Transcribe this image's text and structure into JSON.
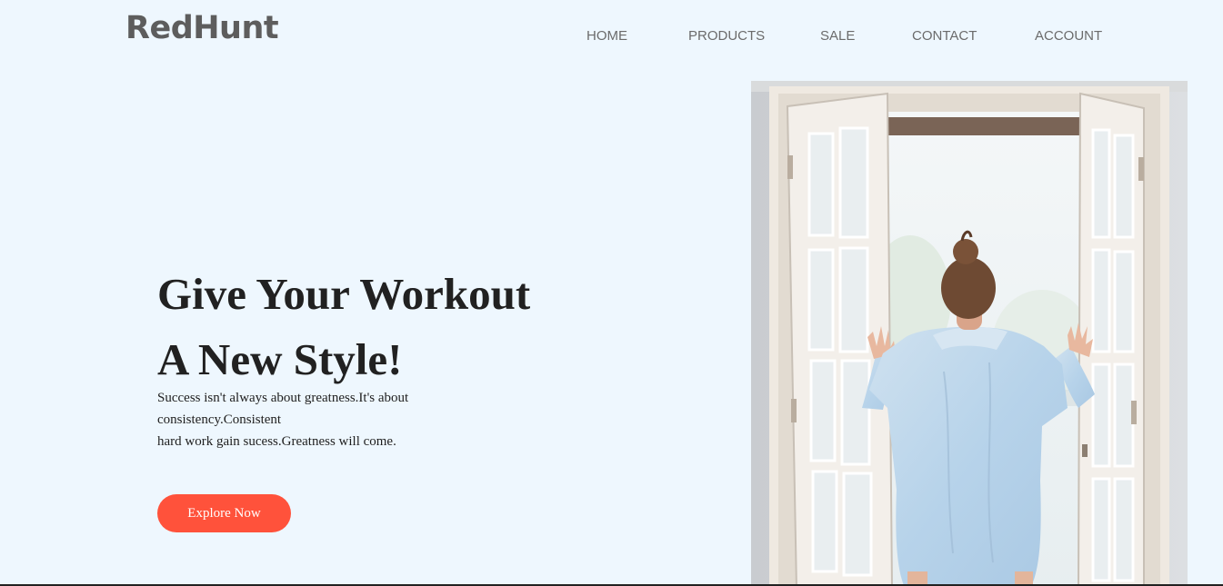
{
  "header": {
    "logo": "RedHunt",
    "nav": [
      {
        "label": "HOME"
      },
      {
        "label": "PRODUCTS"
      },
      {
        "label": "SALE"
      },
      {
        "label": "CONTACT"
      },
      {
        "label": "ACCOUNT"
      }
    ]
  },
  "hero": {
    "title_lines": [
      "Give Your Workout",
      "A New Style!"
    ],
    "text_lines": [
      "Success isn't always about greatness.It's about",
      "consistency.Consistent",
      "hard work gain sucess.Greatness will come."
    ],
    "button_label": "Explore Now"
  },
  "colors": {
    "background": "#eef7fe",
    "accent": "#ff523b",
    "logo": "#5d5d5d"
  }
}
